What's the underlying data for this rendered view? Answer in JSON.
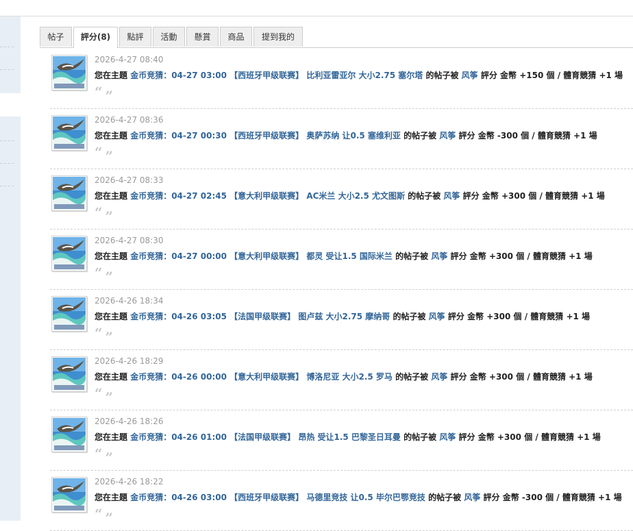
{
  "tabs": [
    {
      "label": "帖子",
      "active": false
    },
    {
      "label": "評分(8)",
      "active": true
    },
    {
      "label": "點評",
      "active": false
    },
    {
      "label": "活動",
      "active": false
    },
    {
      "label": "懸賞",
      "active": false
    },
    {
      "label": "商品",
      "active": false
    },
    {
      "label": "提到我的",
      "active": false
    }
  ],
  "common": {
    "prefix": "您在主題",
    "mid": "的帖子被",
    "rater": "风筝",
    "rate_word": "評分 金幣",
    "unit_suffix": "個 / 體育競猜 +1 場",
    "quote_open": "“",
    "quote_close": "”"
  },
  "items": [
    {
      "time": "2026-4-27 08:40",
      "thread": "金币竞猜：04-27 03:00 【西班牙甲级联赛】 比利亚雷亚尔 大小2.75 塞尔塔",
      "amount": "+150"
    },
    {
      "time": "2026-4-27 08:36",
      "thread": "金币竞猜：04-27 00:30 【西班牙甲级联赛】 奥萨苏纳 让0.5 塞维利亚",
      "amount": "-300"
    },
    {
      "time": "2026-4-27 08:33",
      "thread": "金币竞猜：04-27 02:45 【意大利甲级联赛】 AC米兰 大小2.5 尤文图斯",
      "amount": "+300"
    },
    {
      "time": "2026-4-27 08:30",
      "thread": "金币竞猜：04-27 00:00 【意大利甲级联赛】 都灵 受让1.5 国际米兰",
      "amount": "+300"
    },
    {
      "time": "2026-4-26 18:34",
      "thread": "金币竞猜：04-26 03:05 【法国甲级联赛】 图卢兹 大小2.75 摩纳哥",
      "amount": "+300"
    },
    {
      "time": "2026-4-26 18:29",
      "thread": "金币竞猜：04-26 00:00 【意大利甲级联赛】 博洛尼亚 大小2.5 罗马",
      "amount": "+300"
    },
    {
      "time": "2026-4-26 18:26",
      "thread": "金币竞猜：04-26 01:00 【法国甲级联赛】 昂热 受让1.5 巴黎圣日耳曼",
      "amount": "+300"
    },
    {
      "time": "2026-4-26 18:22",
      "thread": "金币竞猜：04-26 03:00 【西班牙甲级联赛】 马德里竞技 让0.5 毕尔巴鄂竞技",
      "amount": "-300"
    }
  ]
}
